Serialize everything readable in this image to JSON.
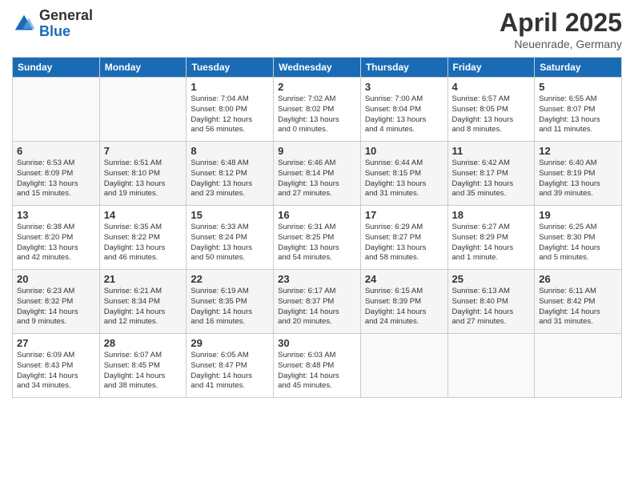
{
  "logo": {
    "general": "General",
    "blue": "Blue"
  },
  "title": "April 2025",
  "subtitle": "Neuenrade, Germany",
  "headers": [
    "Sunday",
    "Monday",
    "Tuesday",
    "Wednesday",
    "Thursday",
    "Friday",
    "Saturday"
  ],
  "weeks": [
    [
      {
        "day": "",
        "info": ""
      },
      {
        "day": "",
        "info": ""
      },
      {
        "day": "1",
        "info": "Sunrise: 7:04 AM\nSunset: 8:00 PM\nDaylight: 12 hours\nand 56 minutes."
      },
      {
        "day": "2",
        "info": "Sunrise: 7:02 AM\nSunset: 8:02 PM\nDaylight: 13 hours\nand 0 minutes."
      },
      {
        "day": "3",
        "info": "Sunrise: 7:00 AM\nSunset: 8:04 PM\nDaylight: 13 hours\nand 4 minutes."
      },
      {
        "day": "4",
        "info": "Sunrise: 6:57 AM\nSunset: 8:05 PM\nDaylight: 13 hours\nand 8 minutes."
      },
      {
        "day": "5",
        "info": "Sunrise: 6:55 AM\nSunset: 8:07 PM\nDaylight: 13 hours\nand 11 minutes."
      }
    ],
    [
      {
        "day": "6",
        "info": "Sunrise: 6:53 AM\nSunset: 8:09 PM\nDaylight: 13 hours\nand 15 minutes."
      },
      {
        "day": "7",
        "info": "Sunrise: 6:51 AM\nSunset: 8:10 PM\nDaylight: 13 hours\nand 19 minutes."
      },
      {
        "day": "8",
        "info": "Sunrise: 6:48 AM\nSunset: 8:12 PM\nDaylight: 13 hours\nand 23 minutes."
      },
      {
        "day": "9",
        "info": "Sunrise: 6:46 AM\nSunset: 8:14 PM\nDaylight: 13 hours\nand 27 minutes."
      },
      {
        "day": "10",
        "info": "Sunrise: 6:44 AM\nSunset: 8:15 PM\nDaylight: 13 hours\nand 31 minutes."
      },
      {
        "day": "11",
        "info": "Sunrise: 6:42 AM\nSunset: 8:17 PM\nDaylight: 13 hours\nand 35 minutes."
      },
      {
        "day": "12",
        "info": "Sunrise: 6:40 AM\nSunset: 8:19 PM\nDaylight: 13 hours\nand 39 minutes."
      }
    ],
    [
      {
        "day": "13",
        "info": "Sunrise: 6:38 AM\nSunset: 8:20 PM\nDaylight: 13 hours\nand 42 minutes."
      },
      {
        "day": "14",
        "info": "Sunrise: 6:35 AM\nSunset: 8:22 PM\nDaylight: 13 hours\nand 46 minutes."
      },
      {
        "day": "15",
        "info": "Sunrise: 6:33 AM\nSunset: 8:24 PM\nDaylight: 13 hours\nand 50 minutes."
      },
      {
        "day": "16",
        "info": "Sunrise: 6:31 AM\nSunset: 8:25 PM\nDaylight: 13 hours\nand 54 minutes."
      },
      {
        "day": "17",
        "info": "Sunrise: 6:29 AM\nSunset: 8:27 PM\nDaylight: 13 hours\nand 58 minutes."
      },
      {
        "day": "18",
        "info": "Sunrise: 6:27 AM\nSunset: 8:29 PM\nDaylight: 14 hours\nand 1 minute."
      },
      {
        "day": "19",
        "info": "Sunrise: 6:25 AM\nSunset: 8:30 PM\nDaylight: 14 hours\nand 5 minutes."
      }
    ],
    [
      {
        "day": "20",
        "info": "Sunrise: 6:23 AM\nSunset: 8:32 PM\nDaylight: 14 hours\nand 9 minutes."
      },
      {
        "day": "21",
        "info": "Sunrise: 6:21 AM\nSunset: 8:34 PM\nDaylight: 14 hours\nand 12 minutes."
      },
      {
        "day": "22",
        "info": "Sunrise: 6:19 AM\nSunset: 8:35 PM\nDaylight: 14 hours\nand 16 minutes."
      },
      {
        "day": "23",
        "info": "Sunrise: 6:17 AM\nSunset: 8:37 PM\nDaylight: 14 hours\nand 20 minutes."
      },
      {
        "day": "24",
        "info": "Sunrise: 6:15 AM\nSunset: 8:39 PM\nDaylight: 14 hours\nand 24 minutes."
      },
      {
        "day": "25",
        "info": "Sunrise: 6:13 AM\nSunset: 8:40 PM\nDaylight: 14 hours\nand 27 minutes."
      },
      {
        "day": "26",
        "info": "Sunrise: 6:11 AM\nSunset: 8:42 PM\nDaylight: 14 hours\nand 31 minutes."
      }
    ],
    [
      {
        "day": "27",
        "info": "Sunrise: 6:09 AM\nSunset: 8:43 PM\nDaylight: 14 hours\nand 34 minutes."
      },
      {
        "day": "28",
        "info": "Sunrise: 6:07 AM\nSunset: 8:45 PM\nDaylight: 14 hours\nand 38 minutes."
      },
      {
        "day": "29",
        "info": "Sunrise: 6:05 AM\nSunset: 8:47 PM\nDaylight: 14 hours\nand 41 minutes."
      },
      {
        "day": "30",
        "info": "Sunrise: 6:03 AM\nSunset: 8:48 PM\nDaylight: 14 hours\nand 45 minutes."
      },
      {
        "day": "",
        "info": ""
      },
      {
        "day": "",
        "info": ""
      },
      {
        "day": "",
        "info": ""
      }
    ]
  ]
}
